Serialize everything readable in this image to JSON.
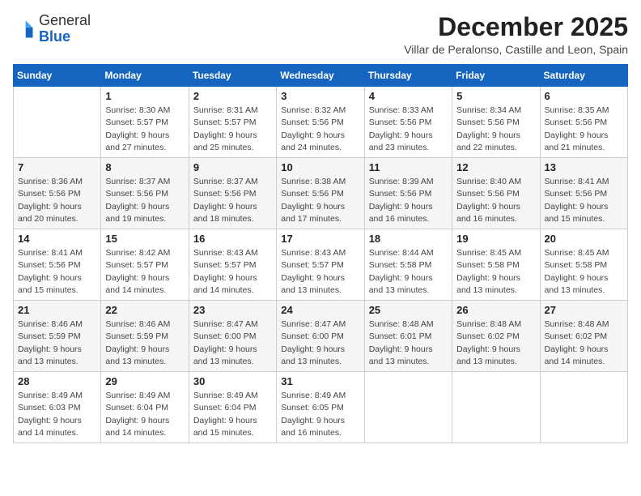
{
  "logo": {
    "general": "General",
    "blue": "Blue"
  },
  "title": "December 2025",
  "location": "Villar de Peralonso, Castille and Leon, Spain",
  "days_of_week": [
    "Sunday",
    "Monday",
    "Tuesday",
    "Wednesday",
    "Thursday",
    "Friday",
    "Saturday"
  ],
  "weeks": [
    [
      {
        "day": "",
        "info": ""
      },
      {
        "day": "1",
        "info": "Sunrise: 8:30 AM\nSunset: 5:57 PM\nDaylight: 9 hours\nand 27 minutes."
      },
      {
        "day": "2",
        "info": "Sunrise: 8:31 AM\nSunset: 5:57 PM\nDaylight: 9 hours\nand 25 minutes."
      },
      {
        "day": "3",
        "info": "Sunrise: 8:32 AM\nSunset: 5:56 PM\nDaylight: 9 hours\nand 24 minutes."
      },
      {
        "day": "4",
        "info": "Sunrise: 8:33 AM\nSunset: 5:56 PM\nDaylight: 9 hours\nand 23 minutes."
      },
      {
        "day": "5",
        "info": "Sunrise: 8:34 AM\nSunset: 5:56 PM\nDaylight: 9 hours\nand 22 minutes."
      },
      {
        "day": "6",
        "info": "Sunrise: 8:35 AM\nSunset: 5:56 PM\nDaylight: 9 hours\nand 21 minutes."
      }
    ],
    [
      {
        "day": "7",
        "info": "Sunrise: 8:36 AM\nSunset: 5:56 PM\nDaylight: 9 hours\nand 20 minutes."
      },
      {
        "day": "8",
        "info": "Sunrise: 8:37 AM\nSunset: 5:56 PM\nDaylight: 9 hours\nand 19 minutes."
      },
      {
        "day": "9",
        "info": "Sunrise: 8:37 AM\nSunset: 5:56 PM\nDaylight: 9 hours\nand 18 minutes."
      },
      {
        "day": "10",
        "info": "Sunrise: 8:38 AM\nSunset: 5:56 PM\nDaylight: 9 hours\nand 17 minutes."
      },
      {
        "day": "11",
        "info": "Sunrise: 8:39 AM\nSunset: 5:56 PM\nDaylight: 9 hours\nand 16 minutes."
      },
      {
        "day": "12",
        "info": "Sunrise: 8:40 AM\nSunset: 5:56 PM\nDaylight: 9 hours\nand 16 minutes."
      },
      {
        "day": "13",
        "info": "Sunrise: 8:41 AM\nSunset: 5:56 PM\nDaylight: 9 hours\nand 15 minutes."
      }
    ],
    [
      {
        "day": "14",
        "info": "Sunrise: 8:41 AM\nSunset: 5:56 PM\nDaylight: 9 hours\nand 15 minutes."
      },
      {
        "day": "15",
        "info": "Sunrise: 8:42 AM\nSunset: 5:57 PM\nDaylight: 9 hours\nand 14 minutes."
      },
      {
        "day": "16",
        "info": "Sunrise: 8:43 AM\nSunset: 5:57 PM\nDaylight: 9 hours\nand 14 minutes."
      },
      {
        "day": "17",
        "info": "Sunrise: 8:43 AM\nSunset: 5:57 PM\nDaylight: 9 hours\nand 13 minutes."
      },
      {
        "day": "18",
        "info": "Sunrise: 8:44 AM\nSunset: 5:58 PM\nDaylight: 9 hours\nand 13 minutes."
      },
      {
        "day": "19",
        "info": "Sunrise: 8:45 AM\nSunset: 5:58 PM\nDaylight: 9 hours\nand 13 minutes."
      },
      {
        "day": "20",
        "info": "Sunrise: 8:45 AM\nSunset: 5:58 PM\nDaylight: 9 hours\nand 13 minutes."
      }
    ],
    [
      {
        "day": "21",
        "info": "Sunrise: 8:46 AM\nSunset: 5:59 PM\nDaylight: 9 hours\nand 13 minutes."
      },
      {
        "day": "22",
        "info": "Sunrise: 8:46 AM\nSunset: 5:59 PM\nDaylight: 9 hours\nand 13 minutes."
      },
      {
        "day": "23",
        "info": "Sunrise: 8:47 AM\nSunset: 6:00 PM\nDaylight: 9 hours\nand 13 minutes."
      },
      {
        "day": "24",
        "info": "Sunrise: 8:47 AM\nSunset: 6:00 PM\nDaylight: 9 hours\nand 13 minutes."
      },
      {
        "day": "25",
        "info": "Sunrise: 8:48 AM\nSunset: 6:01 PM\nDaylight: 9 hours\nand 13 minutes."
      },
      {
        "day": "26",
        "info": "Sunrise: 8:48 AM\nSunset: 6:02 PM\nDaylight: 9 hours\nand 13 minutes."
      },
      {
        "day": "27",
        "info": "Sunrise: 8:48 AM\nSunset: 6:02 PM\nDaylight: 9 hours\nand 14 minutes."
      }
    ],
    [
      {
        "day": "28",
        "info": "Sunrise: 8:49 AM\nSunset: 6:03 PM\nDaylight: 9 hours\nand 14 minutes."
      },
      {
        "day": "29",
        "info": "Sunrise: 8:49 AM\nSunset: 6:04 PM\nDaylight: 9 hours\nand 14 minutes."
      },
      {
        "day": "30",
        "info": "Sunrise: 8:49 AM\nSunset: 6:04 PM\nDaylight: 9 hours\nand 15 minutes."
      },
      {
        "day": "31",
        "info": "Sunrise: 8:49 AM\nSunset: 6:05 PM\nDaylight: 9 hours\nand 16 minutes."
      },
      {
        "day": "",
        "info": ""
      },
      {
        "day": "",
        "info": ""
      },
      {
        "day": "",
        "info": ""
      }
    ]
  ]
}
